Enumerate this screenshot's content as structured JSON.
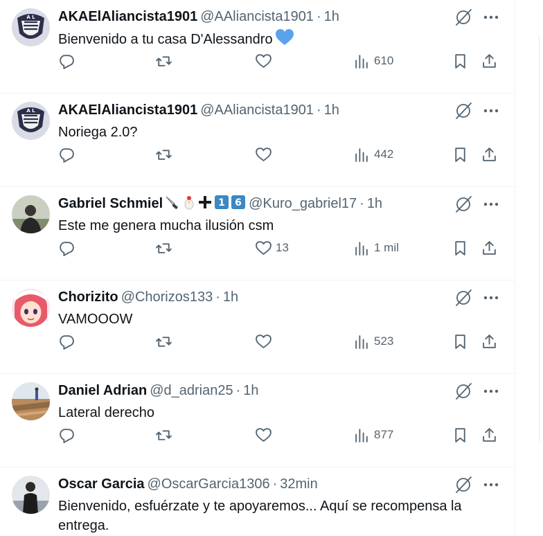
{
  "tweets": [
    {
      "name": "AKAElAliancista1901",
      "handle": "@AAliancista1901",
      "sep": "·",
      "time": "1h",
      "text": "Bienvenido a tu casa D'Alessandro",
      "likes": "",
      "views": "610",
      "avatar": "alianza-crest-avatar"
    },
    {
      "name": "AKAElAliancista1901",
      "handle": "@AAliancista1901",
      "sep": "·",
      "time": "1h",
      "text": "Noriega 2.0?",
      "likes": "",
      "views": "442",
      "avatar": "alianza-crest-avatar"
    },
    {
      "name": "Gabriel Schmiel",
      "handle": "@Kuro_gabriel17",
      "sep": "·",
      "time": "1h",
      "text": "Este me genera mucha ilusión csm",
      "likes": "13",
      "views": "1 mil",
      "avatar": "person-photo-avatar"
    },
    {
      "name": "Chorizito",
      "handle": "@Chorizos133",
      "sep": "·",
      "time": "1h",
      "text": "VAMOOOW",
      "likes": "",
      "views": "523",
      "avatar": "anime-girl-avatar"
    },
    {
      "name": "Daniel Adrian",
      "handle": "@d_adrian25",
      "sep": "·",
      "time": "1h",
      "text": "Lateral derecho",
      "likes": "",
      "views": "877",
      "avatar": "beach-photo-avatar"
    },
    {
      "name": "Oscar Garcia",
      "handle": "@OscarGarcia1306",
      "sep": "·",
      "time": "32min",
      "text": "Bienvenido, esfuérzate y te apoyaremos... Aquí se recompensa la entrega.",
      "likes": "",
      "views": "",
      "avatar": "man-photo-avatar"
    }
  ],
  "emoji_suffix": [
    "knife-emoji",
    "chicken-emoji",
    "plus-emoji",
    "keycap-1-emoji",
    "keycap-6-emoji"
  ],
  "colors": {
    "text": "#0f1419",
    "secondary": "#536471",
    "heart": "#5ba2ec",
    "border": "#eff3f4"
  }
}
